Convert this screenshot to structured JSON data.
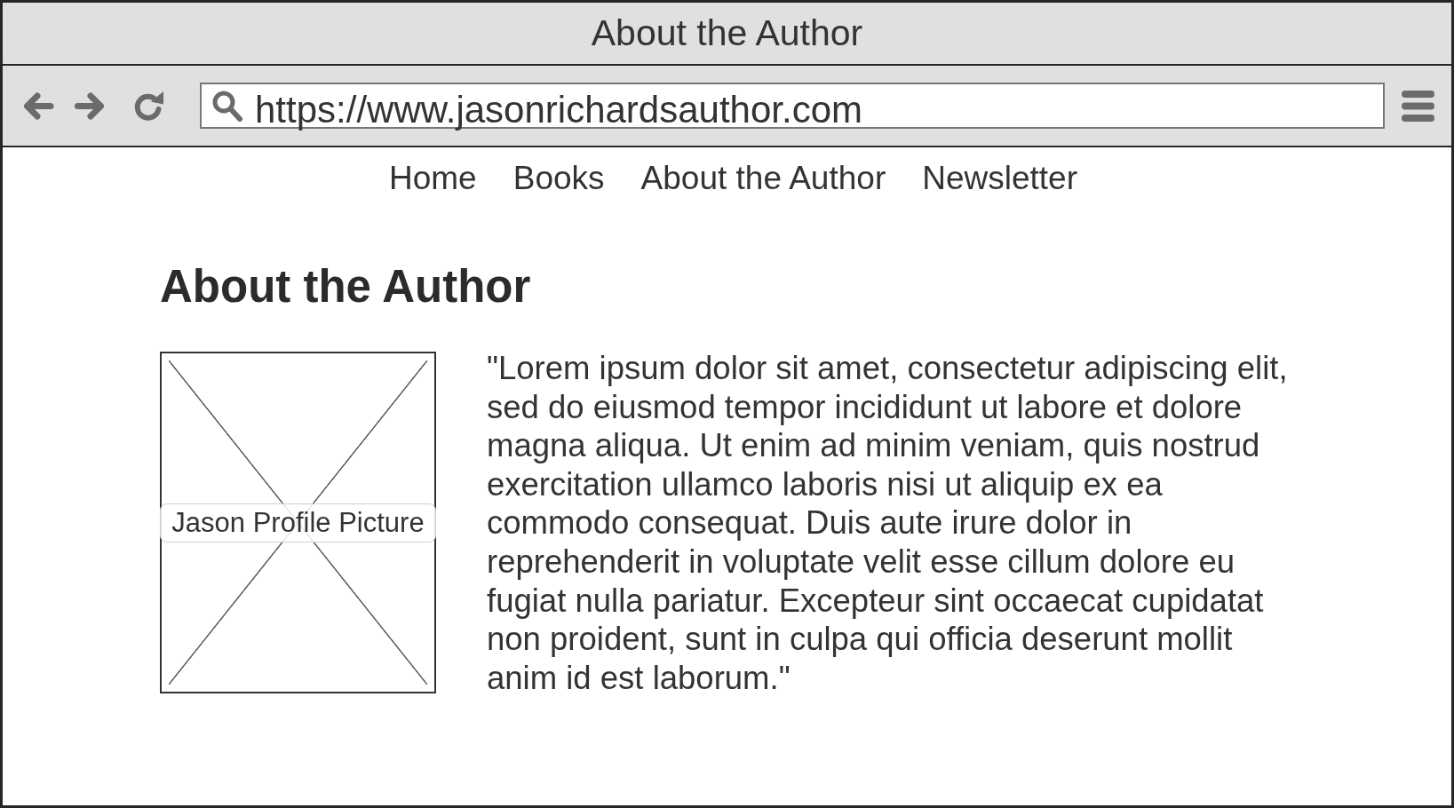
{
  "window": {
    "title": "About the Author"
  },
  "toolbar": {
    "url": "https://www.jasonrichardsauthor.com"
  },
  "nav_links": [
    "Home",
    "Books",
    "About the Author",
    "Newsletter"
  ],
  "page": {
    "heading": "About the Author",
    "image": {
      "label": "Jason Profile Picture"
    },
    "bio": "\"Lorem ipsum dolor sit amet, consectetur adipiscing elit, sed do eiusmod tempor incididunt ut labore et dolore magna aliqua. Ut enim ad minim veniam, quis nostrud exercitation ullamco laboris nisi ut aliquip ex ea commodo consequat. Duis aute irure dolor in reprehenderit in voluptate velit esse cillum dolore eu fugiat nulla pariatur. Excepteur sint occaecat cupidatat non proident, sunt in culpa qui officia deserunt mollit anim id est laborum.\""
  }
}
